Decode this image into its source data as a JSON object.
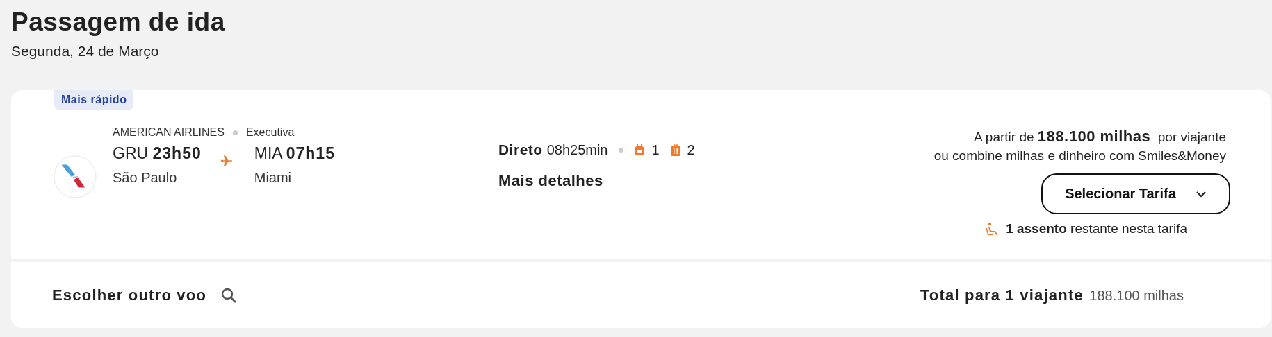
{
  "header": {
    "title": "Passagem de ida",
    "date": "Segunda, 24 de Março"
  },
  "flight": {
    "badge": "Mais rápido",
    "airline": "AMERICAN AIRLINES",
    "cabin": "Executiva",
    "origin": {
      "code": "GRU",
      "time": "23h50",
      "city": "São Paulo"
    },
    "destination": {
      "code": "MIA",
      "time": "07h15",
      "city": "Miami"
    },
    "stop_type": "Direto",
    "duration": "08h25min",
    "baggage": [
      {
        "kind": "backpack",
        "count": "1"
      },
      {
        "kind": "suitcase",
        "count": "2"
      }
    ],
    "details_link": "Mais detalhes",
    "price_line": "A partir de **188.100 milhas**  por viajante",
    "combine_line": "ou combine milhas e dinheiro com Smiles&Money",
    "select_button": "Selecionar Tarifa",
    "seats_line": "**1 assento** restante nesta tarifa"
  },
  "footer": {
    "other_flight": "Escolher outro voo",
    "total_label": "Total para 1 viajante",
    "total_value": "188.100 milhas"
  }
}
